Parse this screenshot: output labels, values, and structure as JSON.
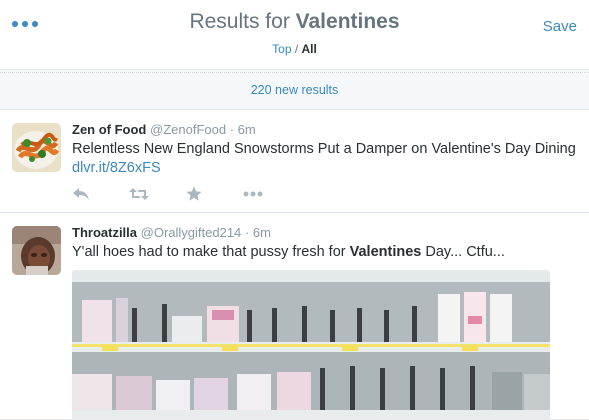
{
  "header": {
    "title_prefix": "Results for ",
    "title_query": "Valentines",
    "filter_top": "Top",
    "filter_sep": " / ",
    "filter_all": "All",
    "save_label": "Save",
    "menu_icon": "more-dots-icon"
  },
  "banner": {
    "text": "220 new results"
  },
  "tweets": [
    {
      "name": "Zen of Food",
      "handle": "@ZenofFood",
      "time": "6m",
      "text": "Relentless New England Snowstorms Put a Damper on Valentine's Day Dining ",
      "link": "dlvr.it/8Z6xFS",
      "avatar_icon": "food-avatar-image",
      "actions": [
        "reply-icon",
        "retweet-icon",
        "favorite-icon",
        "more-icon"
      ]
    },
    {
      "name": "Throatzilla",
      "handle": "@Orallygifted214",
      "time": "6m",
      "text_before": "Y'all hoes had to make that pussy fresh for ",
      "text_bold": "Valentines",
      "text_after": " Day... Ctfu...",
      "avatar_icon": "user-avatar-image",
      "photo": "store-shelf-photo"
    }
  ],
  "colors": {
    "accent": "#3b88c3",
    "muted": "#8899a6",
    "text": "#292f33",
    "border": "#e1e8ed"
  }
}
